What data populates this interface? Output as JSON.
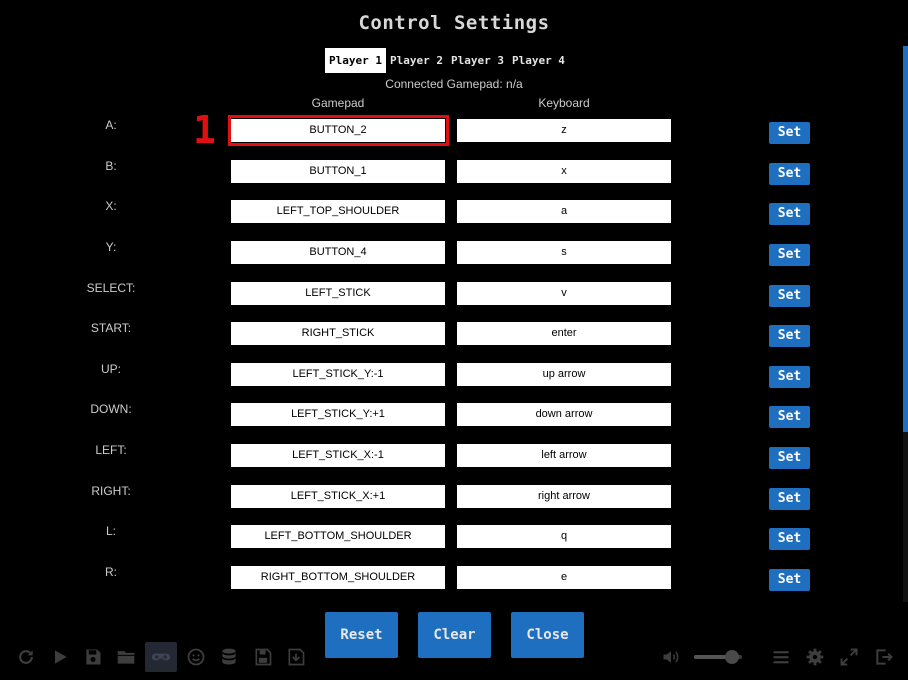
{
  "title": "Control Settings",
  "tabs": [
    {
      "label": "Player 1",
      "active": true
    },
    {
      "label": "Player 2",
      "active": false
    },
    {
      "label": "Player 3",
      "active": false
    },
    {
      "label": "Player 4",
      "active": false
    }
  ],
  "gamepad_info": "Connected Gamepad: n/a",
  "columns": {
    "gamepad": "Gamepad",
    "keyboard": "Keyboard"
  },
  "set_label": "Set",
  "annotation_marker": "1",
  "mappings": [
    {
      "label": "A:",
      "gamepad": "BUTTON_2",
      "keyboard": "z"
    },
    {
      "label": "B:",
      "gamepad": "BUTTON_1",
      "keyboard": "x"
    },
    {
      "label": "X:",
      "gamepad": "LEFT_TOP_SHOULDER",
      "keyboard": "a"
    },
    {
      "label": "Y:",
      "gamepad": "BUTTON_4",
      "keyboard": "s"
    },
    {
      "label": "SELECT:",
      "gamepad": "LEFT_STICK",
      "keyboard": "v"
    },
    {
      "label": "START:",
      "gamepad": "RIGHT_STICK",
      "keyboard": "enter"
    },
    {
      "label": "UP:",
      "gamepad": "LEFT_STICK_Y:-1",
      "keyboard": "up arrow"
    },
    {
      "label": "DOWN:",
      "gamepad": "LEFT_STICK_Y:+1",
      "keyboard": "down arrow"
    },
    {
      "label": "LEFT:",
      "gamepad": "LEFT_STICK_X:-1",
      "keyboard": "left arrow"
    },
    {
      "label": "RIGHT:",
      "gamepad": "LEFT_STICK_X:+1",
      "keyboard": "right arrow"
    },
    {
      "label": "L:",
      "gamepad": "LEFT_BOTTOM_SHOULDER",
      "keyboard": "q"
    },
    {
      "label": "R:",
      "gamepad": "RIGHT_BOTTOM_SHOULDER",
      "keyboard": "e"
    }
  ],
  "actions": {
    "reset": "Reset",
    "clear": "Clear",
    "close": "Close"
  },
  "toolbar": {
    "left_icons": [
      "restart-icon",
      "play-icon",
      "save-icon",
      "folder-icon",
      "gamepad-icon",
      "smiley-icon",
      "database-icon",
      "save-state-icon",
      "load-state-icon"
    ],
    "right_icons": [
      "volume-icon",
      "menu-icon",
      "settings-icon",
      "fullscreen-icon",
      "exit-icon"
    ],
    "active_icon": "gamepad-icon",
    "volume": 0.8
  },
  "colors": {
    "accent": "#1f6fc0",
    "highlight": "#e01010",
    "background": "#000000"
  }
}
